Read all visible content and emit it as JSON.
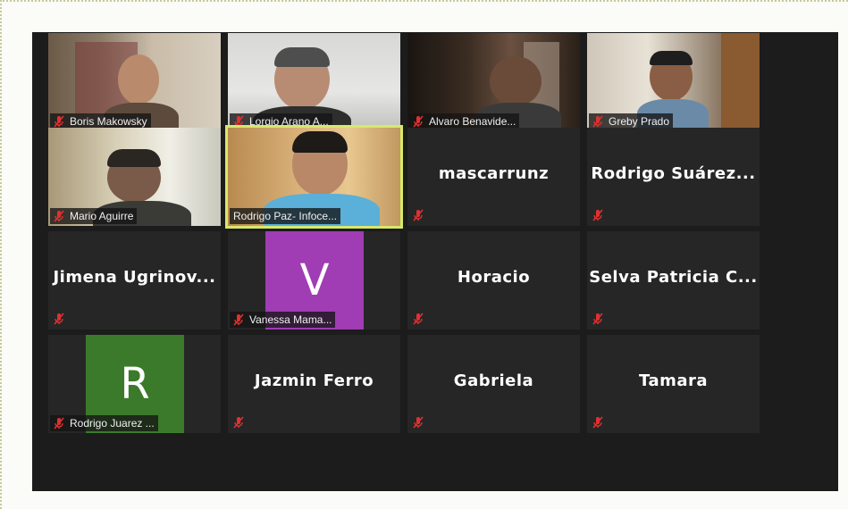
{
  "participants": [
    {
      "name": "Boris Makowsky",
      "muted": true
    },
    {
      "name": "Lorgio Arano A...",
      "muted": true
    },
    {
      "name": "Alvaro Benavide...",
      "muted": true
    },
    {
      "name": "Greby Prado",
      "muted": true
    },
    {
      "name": "Mario Aguirre",
      "muted": true
    },
    {
      "name": "Rodrigo Paz- Infoce...",
      "muted": false,
      "active_speaker": true
    },
    {
      "name": "mascarrunz",
      "muted": true
    },
    {
      "name": "Rodrigo Suárez...",
      "muted": true
    },
    {
      "name": "Jimena Ugrinov...",
      "muted": true
    },
    {
      "name": "Vanessa Mama...",
      "muted": true,
      "avatar_letter": "V",
      "avatar_color": "#a03cb4"
    },
    {
      "name": "Horacio",
      "muted": true
    },
    {
      "name": "Selva Patricia C...",
      "muted": true
    },
    {
      "name": "Rodrigo Juarez ...",
      "muted": true,
      "avatar_letter": "R",
      "avatar_color": "#3b7a2a"
    },
    {
      "name": "Jazmin Ferro",
      "muted": true
    },
    {
      "name": "Gabriela",
      "muted": true
    },
    {
      "name": "Tamara",
      "muted": true
    }
  ],
  "colors": {
    "background": "#1c1c1c",
    "tile": "#262626",
    "active_border": "#d8e86a",
    "mute_icon": "#e03030"
  }
}
